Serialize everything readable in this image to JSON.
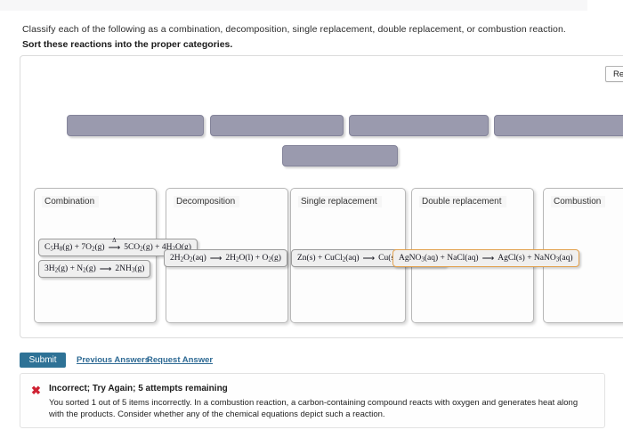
{
  "prompt": {
    "instruction": "Classify each of the following as a combination, decomposition, single replacement, double replacement, or combustion reaction.",
    "task": "Sort these reactions into the proper categories."
  },
  "reset_button": "Reset",
  "source_slots": [
    {
      "id": "slot-1",
      "label": ""
    },
    {
      "id": "slot-2",
      "label": ""
    },
    {
      "id": "slot-3",
      "label": ""
    },
    {
      "id": "slot-4",
      "label": ""
    },
    {
      "id": "slot-5",
      "label": ""
    }
  ],
  "categories": [
    {
      "id": "combination",
      "title": "Combination"
    },
    {
      "id": "decomposition",
      "title": "Decomposition"
    },
    {
      "id": "single-replacement",
      "title": "Single replacement"
    },
    {
      "id": "double-replacement",
      "title": "Double replacement"
    },
    {
      "id": "combustion",
      "title": "Combustion"
    }
  ],
  "equations": [
    {
      "id": "eq-combustion-pentene",
      "category": "combination",
      "text": "C5H8(g) + 7O2(g) → 5CO2(g) + 4H2O(g)",
      "condition": "Δ",
      "status": "normal"
    },
    {
      "id": "eq-ammonia",
      "category": "combination",
      "text": "3H2(g) + N2(g) ⟶ 2NH3(g)",
      "status": "normal"
    },
    {
      "id": "eq-peroxide",
      "category": "decomposition",
      "text": "2H2O2(aq) ⟶ 2H2O(l) + O2(g)",
      "status": "normal"
    },
    {
      "id": "eq-zinc-copper",
      "category": "single-replacement",
      "text": "Zn(s) + CuCl2(aq) ⟶ Cu(s) + ZnCl2(aq)",
      "status": "normal"
    },
    {
      "id": "eq-silver-chloride",
      "category": "double-replacement",
      "text": "AgNO3(aq) + NaCl(aq) ⟶ AgCl(s) + NaNO3(aq)",
      "status": "incorrect"
    }
  ],
  "actions": {
    "submit": "Submit",
    "previous_answers": "Previous Answers",
    "request_answer": "Request Answer"
  },
  "feedback": {
    "icon": "x-mark",
    "title": "Incorrect; Try Again; 5 attempts remaining",
    "body": "You sorted 1 out of 5 items incorrectly. In a combustion reaction, a carbon-containing compound reacts with oxygen and generates heat along with the products. Consider whether any of the chemical equations depict such a reaction.",
    "accent_color": "#cf2233"
  },
  "colors": {
    "slot_fill": "#9a9aae",
    "submit_bg": "#2e7296",
    "link": "#2e6a94",
    "incorrect_border": "#e2a14e"
  }
}
